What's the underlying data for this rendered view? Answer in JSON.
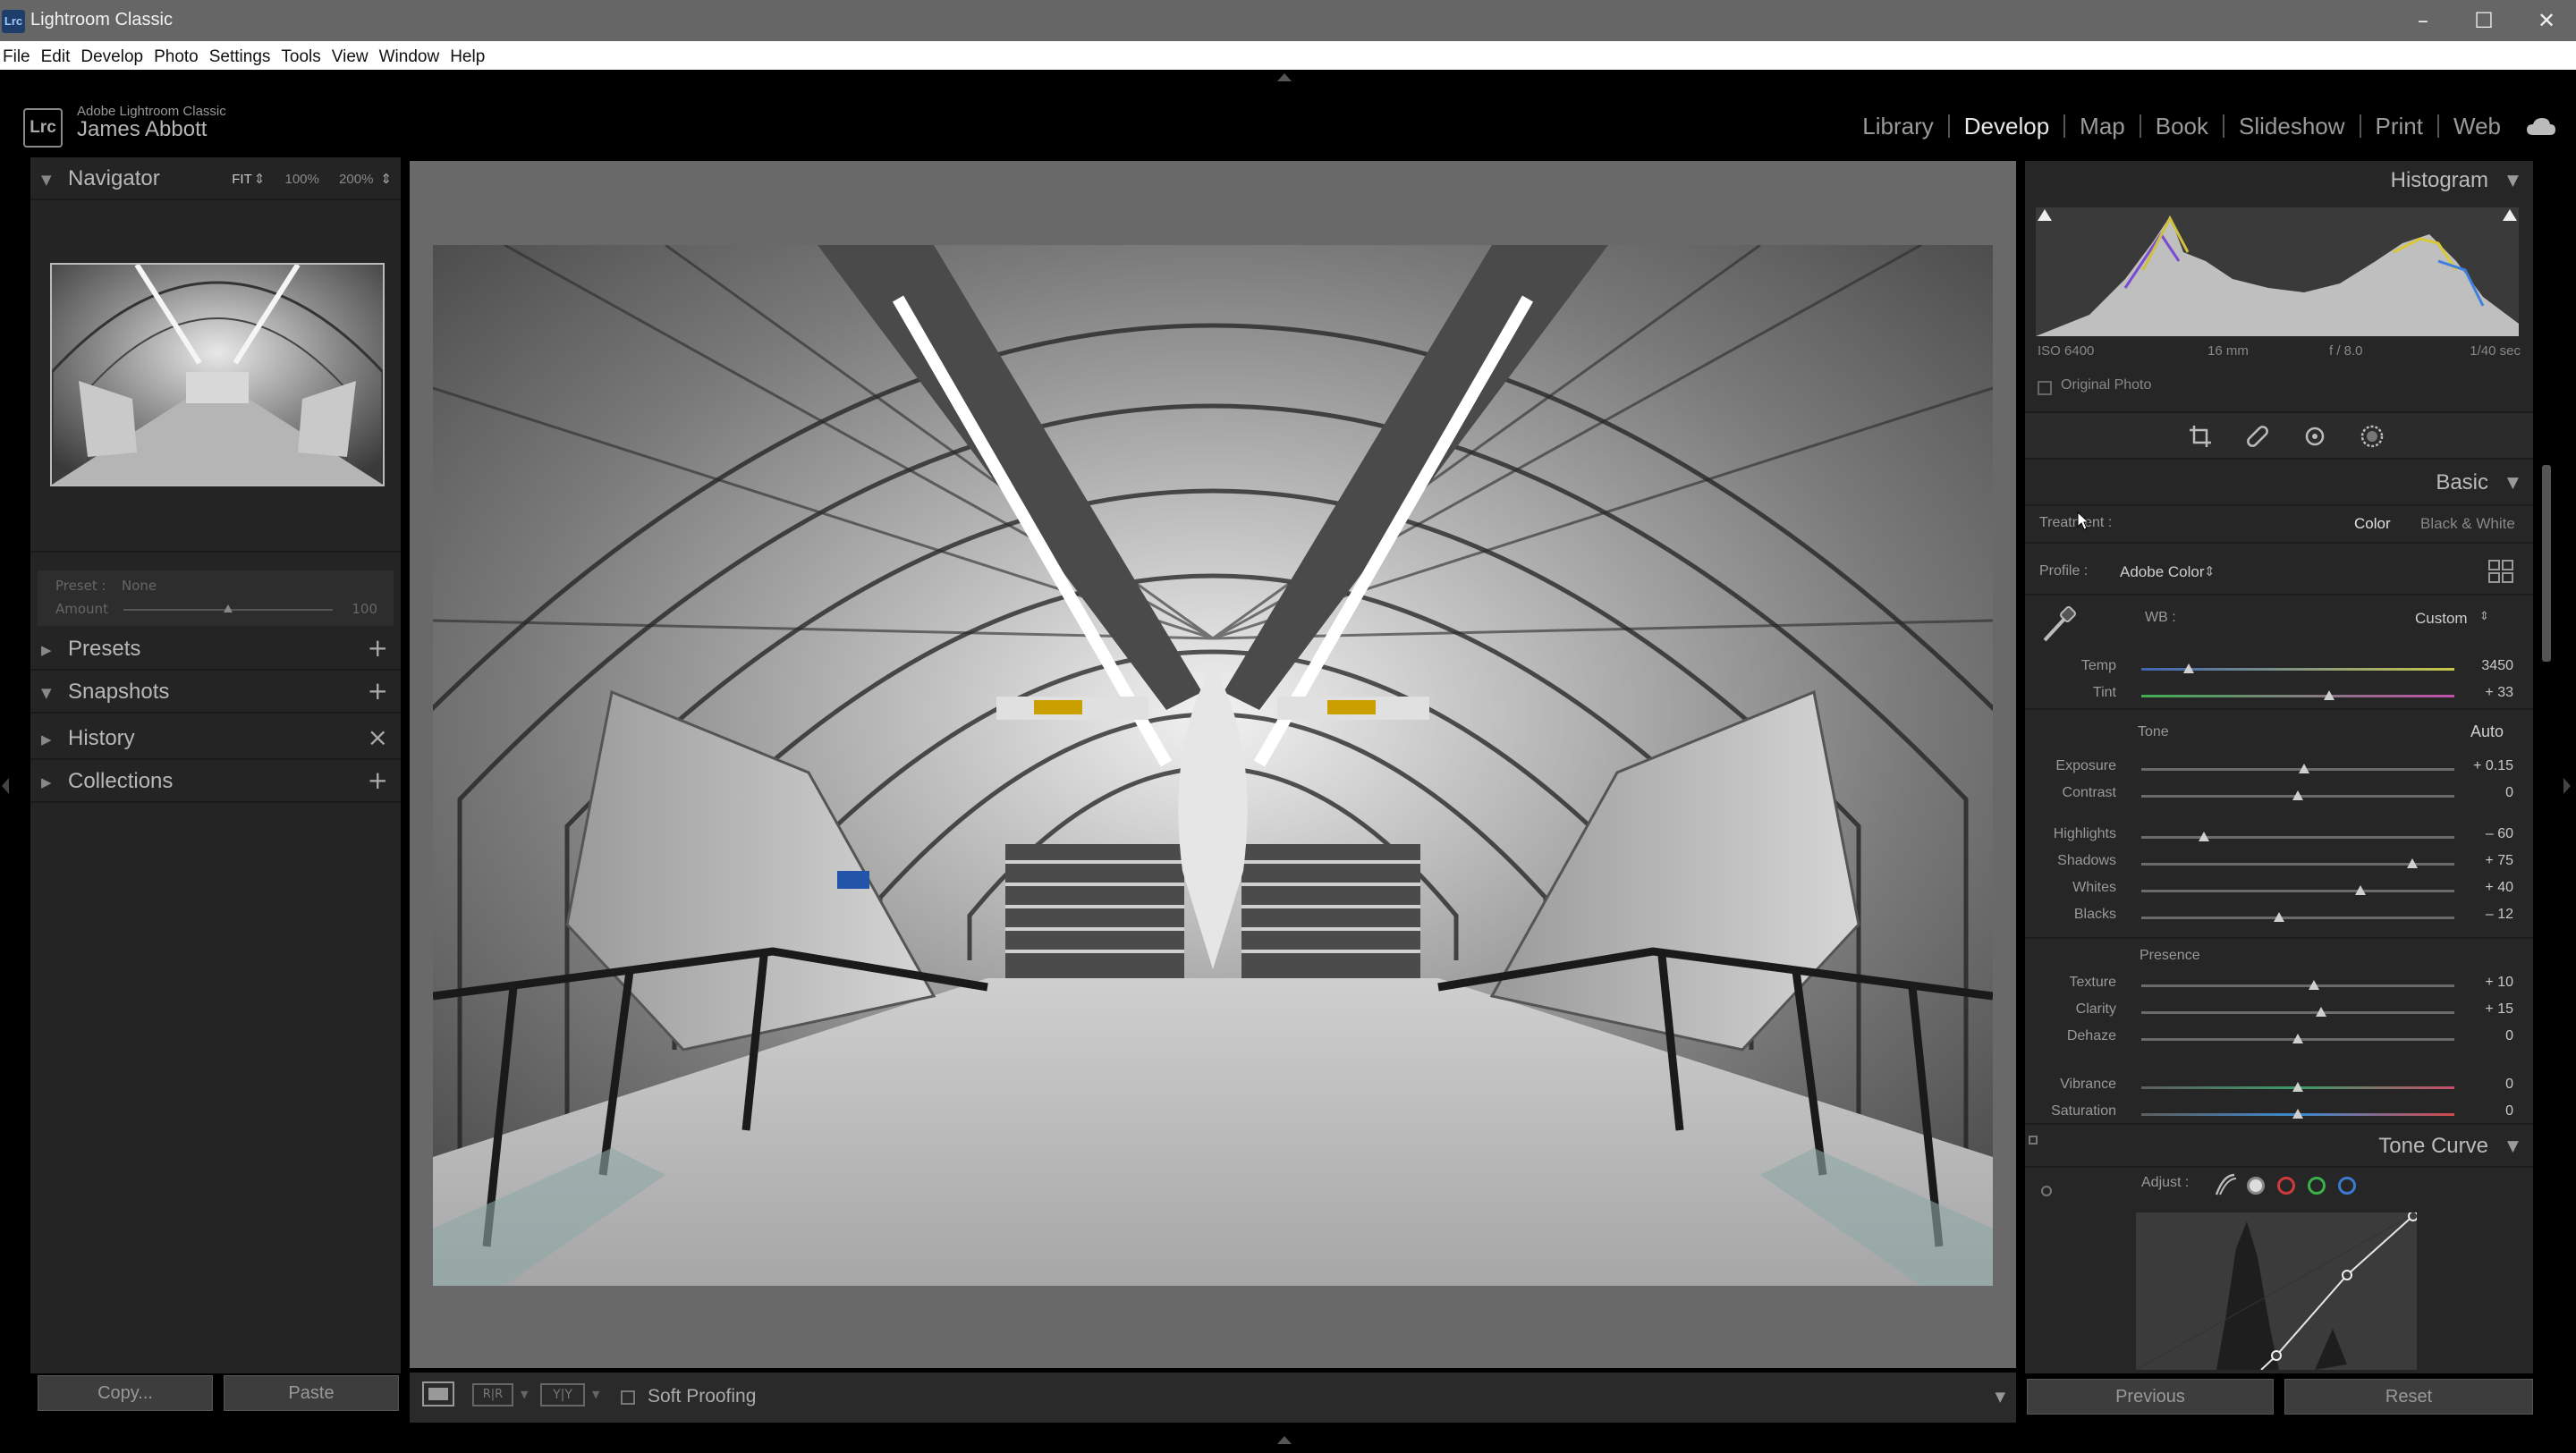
{
  "window": {
    "app_badge": "Lrc",
    "title": "Lightroom Classic",
    "minimize_icon": "minimize-icon",
    "maximize_icon": "maximize-icon",
    "close_icon": "close-icon"
  },
  "menu": [
    "File",
    "Edit",
    "Develop",
    "Photo",
    "Settings",
    "Tools",
    "View",
    "Window",
    "Help"
  ],
  "identity": {
    "badge": "Lrc",
    "product": "Adobe Lightroom Classic",
    "user": "James Abbott"
  },
  "modules": {
    "items": [
      "Library",
      "Develop",
      "Map",
      "Book",
      "Slideshow",
      "Print",
      "Web"
    ],
    "active": "Develop"
  },
  "left_panel": {
    "navigator": {
      "title": "Navigator",
      "zoom_options": [
        "FIT",
        "100%",
        "200%"
      ],
      "zoom_selected": "FIT"
    },
    "preset": {
      "label": "Preset :",
      "value": "None",
      "amount_label": "Amount",
      "amount_value": "100",
      "amount_fraction": 0.5
    },
    "sections": [
      {
        "title": "Presets",
        "action": "+",
        "expanded": false
      },
      {
        "title": "Snapshots",
        "action": "+",
        "expanded": true
      },
      {
        "title": "History",
        "action": "×",
        "expanded": false
      },
      {
        "title": "Collections",
        "action": "+",
        "expanded": false
      }
    ],
    "copy_button": "Copy...",
    "paste_button": "Paste"
  },
  "toolbar": {
    "soft_proofing": "Soft Proofing",
    "view_icons": [
      "loupe-view-icon",
      "before-after-icon",
      "yy-icon"
    ],
    "yy_label": "Y|Y"
  },
  "right_panel": {
    "histogram": {
      "title": "Histogram",
      "iso": "ISO 6400",
      "focal": "16 mm",
      "aperture": "f / 8.0",
      "shutter": "1/40 sec",
      "original_photo": "Original Photo"
    },
    "tools": [
      "crop-icon",
      "healing-icon",
      "red-eye-icon",
      "masking-icon"
    ],
    "basic": {
      "title": "Basic",
      "treatment_label": "Treatment :",
      "treatment_color": "Color",
      "treatment_bw": "Black & White",
      "profile_label": "Profile :",
      "profile_value": "Adobe Color",
      "wb_label": "WB :",
      "wb_value": "Custom",
      "wb_sliders": [
        {
          "label": "Temp",
          "value": "3450",
          "pos": 0.15,
          "gradient": "linear-gradient(90deg,#3f64b4,#c8c84a)"
        },
        {
          "label": "Tint",
          "value": "+ 33",
          "pos": 0.6,
          "gradient": "linear-gradient(90deg,#3fae53,#c04fa8)"
        }
      ],
      "tone_label": "Tone",
      "tone_auto": "Auto",
      "tone_sliders": [
        {
          "label": "Exposure",
          "value": "+ 0.15",
          "pos": 0.52
        },
        {
          "label": "Contrast",
          "value": "0",
          "pos": 0.5
        }
      ],
      "tone_sliders2": [
        {
          "label": "Highlights",
          "value": "– 60",
          "pos": 0.2
        },
        {
          "label": "Shadows",
          "value": "+ 75",
          "pos": 0.865
        },
        {
          "label": "Whites",
          "value": "+ 40",
          "pos": 0.7
        },
        {
          "label": "Blacks",
          "value": "– 12",
          "pos": 0.44
        }
      ],
      "presence_label": "Presence",
      "presence_sliders": [
        {
          "label": "Texture",
          "value": "+ 10",
          "pos": 0.55
        },
        {
          "label": "Clarity",
          "value": "+ 15",
          "pos": 0.575
        },
        {
          "label": "Dehaze",
          "value": "0",
          "pos": 0.5
        }
      ],
      "color_sliders": [
        {
          "label": "Vibrance",
          "value": "0",
          "pos": 0.5,
          "gradient": "linear-gradient(90deg,#5e5e5e,#3a9a6a,#c94c6a)"
        },
        {
          "label": "Saturation",
          "value": "0",
          "pos": 0.5,
          "gradient": "linear-gradient(90deg,#5e5e5e,#3a8ad0,#d04a4a)"
        }
      ]
    },
    "tone_curve": {
      "title": "Tone Curve",
      "adjust_label": "Adjust :"
    },
    "previous_button": "Previous",
    "reset_button": "Reset"
  }
}
